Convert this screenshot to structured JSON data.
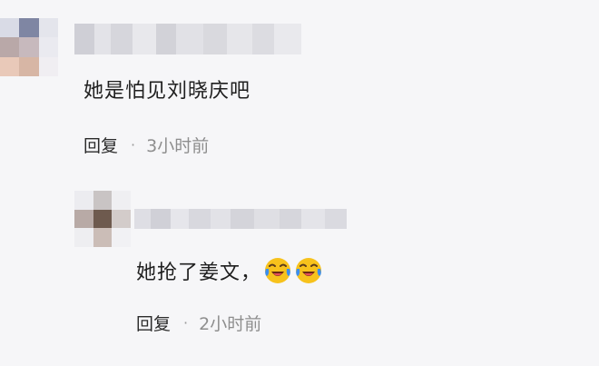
{
  "comments": [
    {
      "text": "她是怕见刘晓庆吧",
      "reply_label": "回复",
      "separator": "·",
      "time": "3小时前"
    },
    {
      "text": "她抢了姜文，",
      "emojis": [
        "laughing-crying-emoji",
        "laughing-crying-emoji"
      ],
      "reply_label": "回复",
      "separator": "·",
      "time": "2小时前"
    }
  ],
  "colors": {
    "background": "#f6f6f8",
    "text": "#1f1f1f",
    "meta": "#8e8e8e",
    "emoji_face": "#f7c21c",
    "emoji_tears": "#3b8ef0"
  }
}
